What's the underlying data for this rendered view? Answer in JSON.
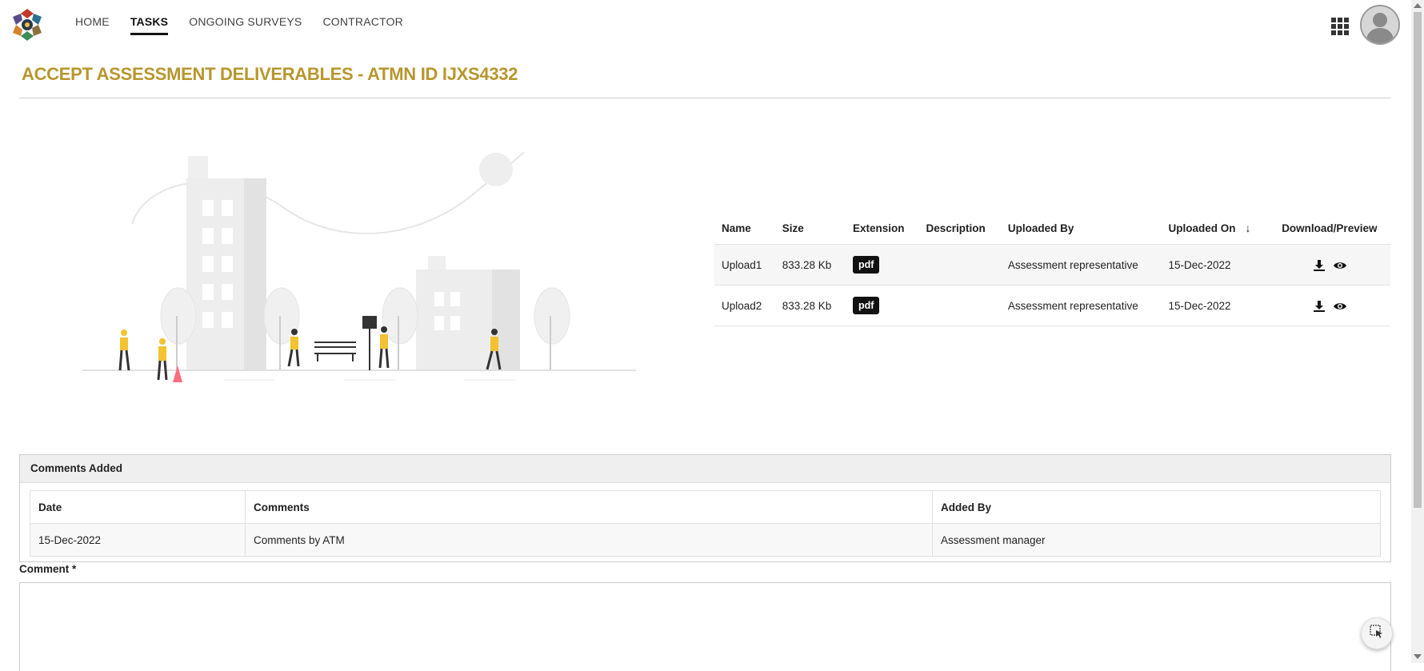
{
  "nav": {
    "items": [
      {
        "label": "HOME",
        "active": false
      },
      {
        "label": "TASKS",
        "active": true
      },
      {
        "label": "ONGOING SURVEYS",
        "active": false
      },
      {
        "label": "CONTRACTOR",
        "active": false
      }
    ]
  },
  "page": {
    "title": "ACCEPT ASSESSMENT DELIVERABLES - ATMN ID IJXS4332",
    "title_color": "#b8962e"
  },
  "files": {
    "headers": {
      "name": "Name",
      "size": "Size",
      "extension": "Extension",
      "description": "Description",
      "uploaded_by": "Uploaded By",
      "uploaded_on": "Uploaded On",
      "actions": "Download/Preview"
    },
    "rows": [
      {
        "name": "Upload1",
        "size": "833.28 Kb",
        "extension": "pdf",
        "description": "",
        "uploaded_by": "Assessment representative",
        "uploaded_on": "15-Dec-2022"
      },
      {
        "name": "Upload2",
        "size": "833.28 Kb",
        "extension": "pdf",
        "description": "",
        "uploaded_by": "Assessment representative",
        "uploaded_on": "15-Dec-2022"
      }
    ]
  },
  "comments": {
    "section_title": "Comments Added",
    "headers": {
      "date": "Date",
      "comments": "Comments",
      "added_by": "Added By"
    },
    "rows": [
      {
        "date": "15-Dec-2022",
        "comments": "Comments by ATM",
        "added_by": "Assessment manager"
      }
    ]
  },
  "comment_form": {
    "label": "Comment *",
    "value": ""
  },
  "icons": {
    "apps": "grid-icon",
    "avatar": "user-avatar",
    "download": "download-icon",
    "preview": "eye-icon",
    "sort": "arrow-down-icon",
    "fab": "cursor-select-icon"
  }
}
